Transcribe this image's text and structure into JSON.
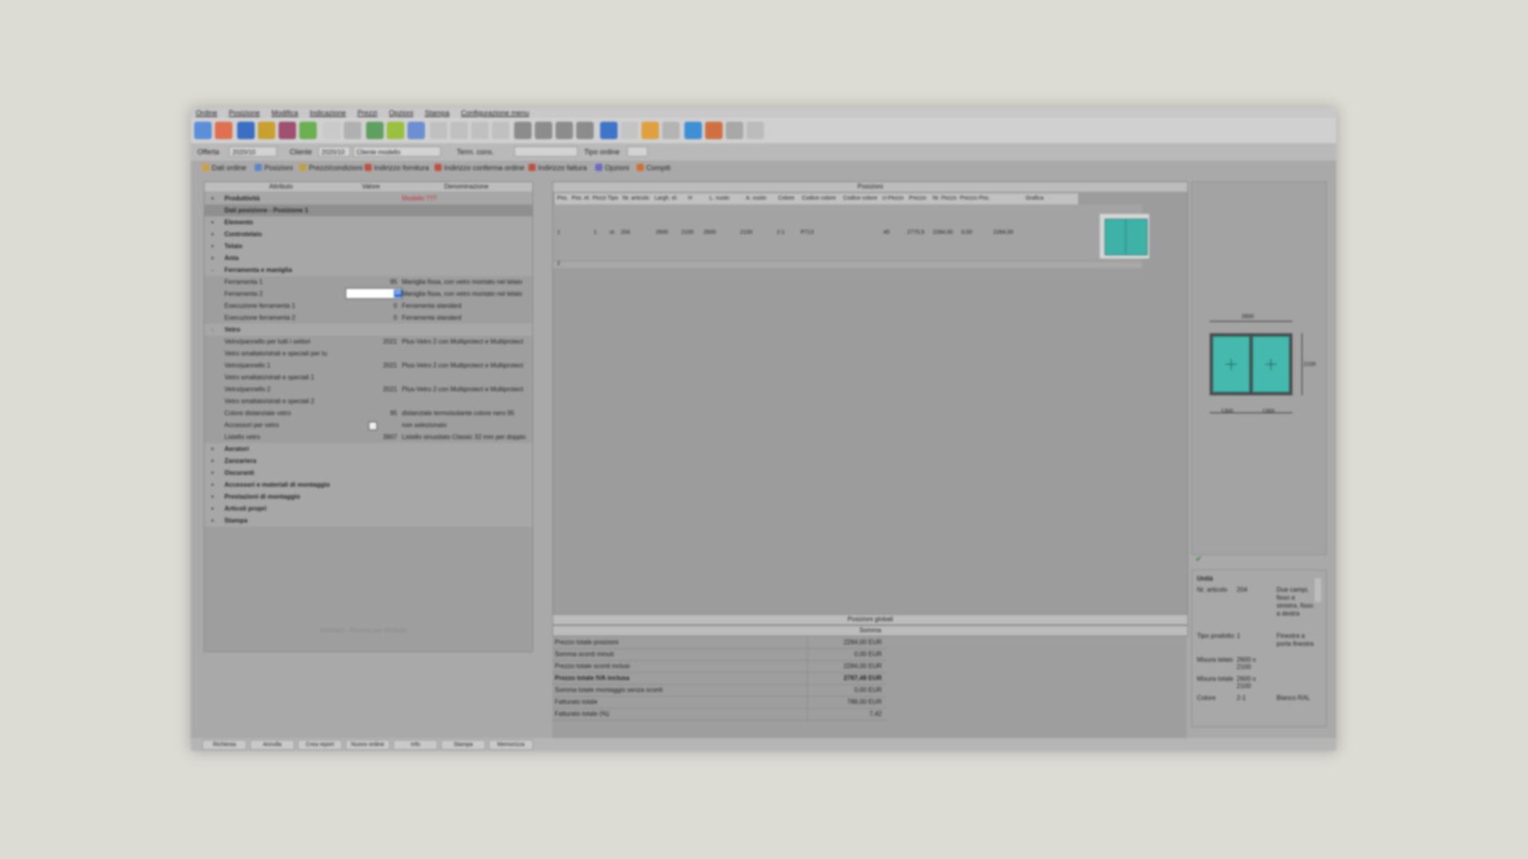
{
  "menu": [
    "Ordine",
    "Posizione",
    "Modifica",
    "Indicazione",
    "Prezzi",
    "Opzioni",
    "Stampa",
    "Configurazione menu"
  ],
  "header": {
    "offerta_label": "Offerta",
    "offerta_value": "2020/10",
    "cliente_label": "Cliente",
    "cliente_code": "2020/10",
    "cliente_name": "Cliente modello",
    "term_label": "Term. cons.",
    "tipo_label": "Tipo ordine"
  },
  "tabs": [
    "Dati ordine",
    "Posizioni",
    "Prezzi/condizioni",
    "Indirizzo fornitura",
    "Indirizzo conferma ordine",
    "Indirizzo fattura",
    "Opzioni",
    "Compiti"
  ],
  "attributes": {
    "columns": [
      "Attributo",
      "Valore",
      "Denominazione"
    ],
    "rows": [
      {
        "toggle": "+",
        "attr": "Produttività",
        "val": "",
        "desc": "Modello ???",
        "bold": true
      },
      {
        "toggle": "",
        "attr": "Dati posizione - Posizione 1",
        "val": "",
        "desc": "",
        "bold": true
      },
      {
        "toggle": "+",
        "attr": "Elemento",
        "val": "",
        "desc": "",
        "bold": true
      },
      {
        "toggle": "+",
        "attr": "Controtelaio",
        "val": "",
        "desc": "",
        "bold": true
      },
      {
        "toggle": "+",
        "attr": "Telaio",
        "val": "",
        "desc": "",
        "bold": true
      },
      {
        "toggle": "+",
        "attr": "Anta",
        "val": "",
        "desc": "",
        "bold": true
      },
      {
        "toggle": "-",
        "attr": "Ferramenta e maniglia",
        "val": "",
        "desc": "",
        "bold": true
      },
      {
        "toggle": "",
        "attr": "Ferramenta 1",
        "val": "95",
        "desc": "Maniglia fissa, con vetro montato nel telaio",
        "bold": false
      },
      {
        "toggle": "",
        "attr": "Ferramenta 2",
        "val": "95",
        "desc": "Maniglia fissa, con vetro montato nel telaio",
        "bold": false,
        "editing": true
      },
      {
        "toggle": "",
        "attr": "Esecuzione ferramenta 1",
        "val": "0",
        "desc": "Ferramenta standard",
        "bold": false
      },
      {
        "toggle": "",
        "attr": "Esecuzione ferramenta 2",
        "val": "0",
        "desc": "Ferramenta standard",
        "bold": false
      },
      {
        "toggle": "-",
        "attr": "Vetro",
        "val": "",
        "desc": "",
        "bold": true
      },
      {
        "toggle": "",
        "attr": "Vetro/pannello per tutti i settori",
        "val": "2021",
        "desc": "Plus-Vetro 2 con Multiprotect e Multiprotect",
        "bold": false
      },
      {
        "toggle": "",
        "attr": "Vetro smaltato/strati e speciali per tu",
        "val": "",
        "desc": "",
        "bold": false
      },
      {
        "toggle": "",
        "attr": "Vetro/pannello 1",
        "val": "2021",
        "desc": "Plus-Vetro 2 con Multiprotect e Multiprotect",
        "bold": false
      },
      {
        "toggle": "",
        "attr": "Vetro smaltato/strati e speciali 1",
        "val": "",
        "desc": "",
        "bold": false
      },
      {
        "toggle": "",
        "attr": "Vetro/pannello 2",
        "val": "2021",
        "desc": "Plus-Vetro 2 con Multiprotect e Multiprotect",
        "bold": false
      },
      {
        "toggle": "",
        "attr": "Vetro smaltato/strati e speciali 2",
        "val": "",
        "desc": "",
        "bold": false
      },
      {
        "toggle": "",
        "attr": "Colore distanziale vetro",
        "val": "95",
        "desc": "distanziale termoisolante colore nero 95",
        "bold": false
      },
      {
        "toggle": "",
        "attr": "Accessori per vetro",
        "val": "",
        "desc": "non selezionato",
        "bold": false,
        "checkbox": true
      },
      {
        "toggle": "",
        "attr": "Listello vetro",
        "val": "3907",
        "desc": "Listello sinusitato Classic 32 mm per doppio",
        "bold": false
      },
      {
        "toggle": "+",
        "attr": "Aeratori",
        "val": "",
        "desc": "",
        "bold": true
      },
      {
        "toggle": "+",
        "attr": "Zanzariera",
        "val": "",
        "desc": "",
        "bold": true
      },
      {
        "toggle": "+",
        "attr": "Oscuranti",
        "val": "",
        "desc": "",
        "bold": true
      },
      {
        "toggle": "+",
        "attr": "Accessori e materiali di montaggio",
        "val": "",
        "desc": "",
        "bold": true
      },
      {
        "toggle": "+",
        "attr": "Prestazioni di montaggio",
        "val": "",
        "desc": "",
        "bold": true
      },
      {
        "toggle": "+",
        "attr": "Articoli propri",
        "val": "",
        "desc": "",
        "bold": true
      },
      {
        "toggle": "+",
        "attr": "Stampa",
        "val": "",
        "desc": "",
        "bold": true
      }
    ],
    "footer": "Attributo - Ricerca per attributo"
  },
  "positions": {
    "title": "Posizioni",
    "columns": [
      "Pos.",
      "Pos. el.",
      "Pezzi",
      "Tipo",
      "Nr. articolo",
      "Largh. el.",
      "H",
      "L. vuoto",
      "A. vuoto",
      "Colore",
      "Codice colore",
      "Codice colore",
      "U-Pezzo",
      "Prezzo",
      "Nr. Pezzo",
      "Prezzo Pos.",
      "Grafica"
    ],
    "row": [
      "1",
      "",
      "1",
      "st.",
      "204",
      "2600",
      "2100",
      "2600",
      "2100",
      "2-1",
      "P713",
      "",
      "45",
      "2775,5",
      "2284,00",
      "0,00",
      "2284,00"
    ],
    "row2": [
      "2",
      "",
      "",
      "",
      "",
      "",
      "",
      "",
      "",
      "",
      "",
      "",
      "",
      "",
      "",
      "",
      ""
    ]
  },
  "sections": {
    "global_positions": "Posizioni globali",
    "totals": "Somma"
  },
  "totals": [
    {
      "label": "Prezzo totale posizioni",
      "value": "2284,00 EUR"
    },
    {
      "label": "Somma sconti minuti",
      "value": "0,00 EUR"
    },
    {
      "label": "Prezzo totale sconti inclusi",
      "value": "2284,00 EUR"
    },
    {
      "label": "Prezzo totale IVA inclusa",
      "value": "2787,48 EUR"
    },
    {
      "label": "Somma totale montaggio senza sconti",
      "value": "0,00 EUR"
    },
    {
      "label": "Fatturato totale",
      "value": "788,00 EUR"
    },
    {
      "label": "Fatturato totale (%)",
      "value": "7,42"
    }
  ],
  "preview": {
    "width_label": "2600",
    "height_label": "2100",
    "sub_left": "1300",
    "sub_right": "1300"
  },
  "info": {
    "title": "Unità",
    "rows": [
      {
        "k": "Nr. articolo",
        "v": "204",
        "d": "Due campi, fisso a sinistra, fisso a destra"
      },
      {
        "k": "Tipo prodotto",
        "v": "1",
        "d": "Finestra a porta finestra"
      },
      {
        "k": "Misura telaio",
        "v": "2600 x 2100",
        "d": ""
      },
      {
        "k": "Misura totale",
        "v": "2600 x 2100",
        "d": ""
      },
      {
        "k": "Colore",
        "v": "2-1",
        "d": "Bianco RAL"
      }
    ]
  },
  "bottom_buttons": [
    "Richiesta",
    "Annulla",
    "Crea report",
    "Nuovo ordine",
    "Info",
    "Stampa",
    "Memorizza"
  ]
}
